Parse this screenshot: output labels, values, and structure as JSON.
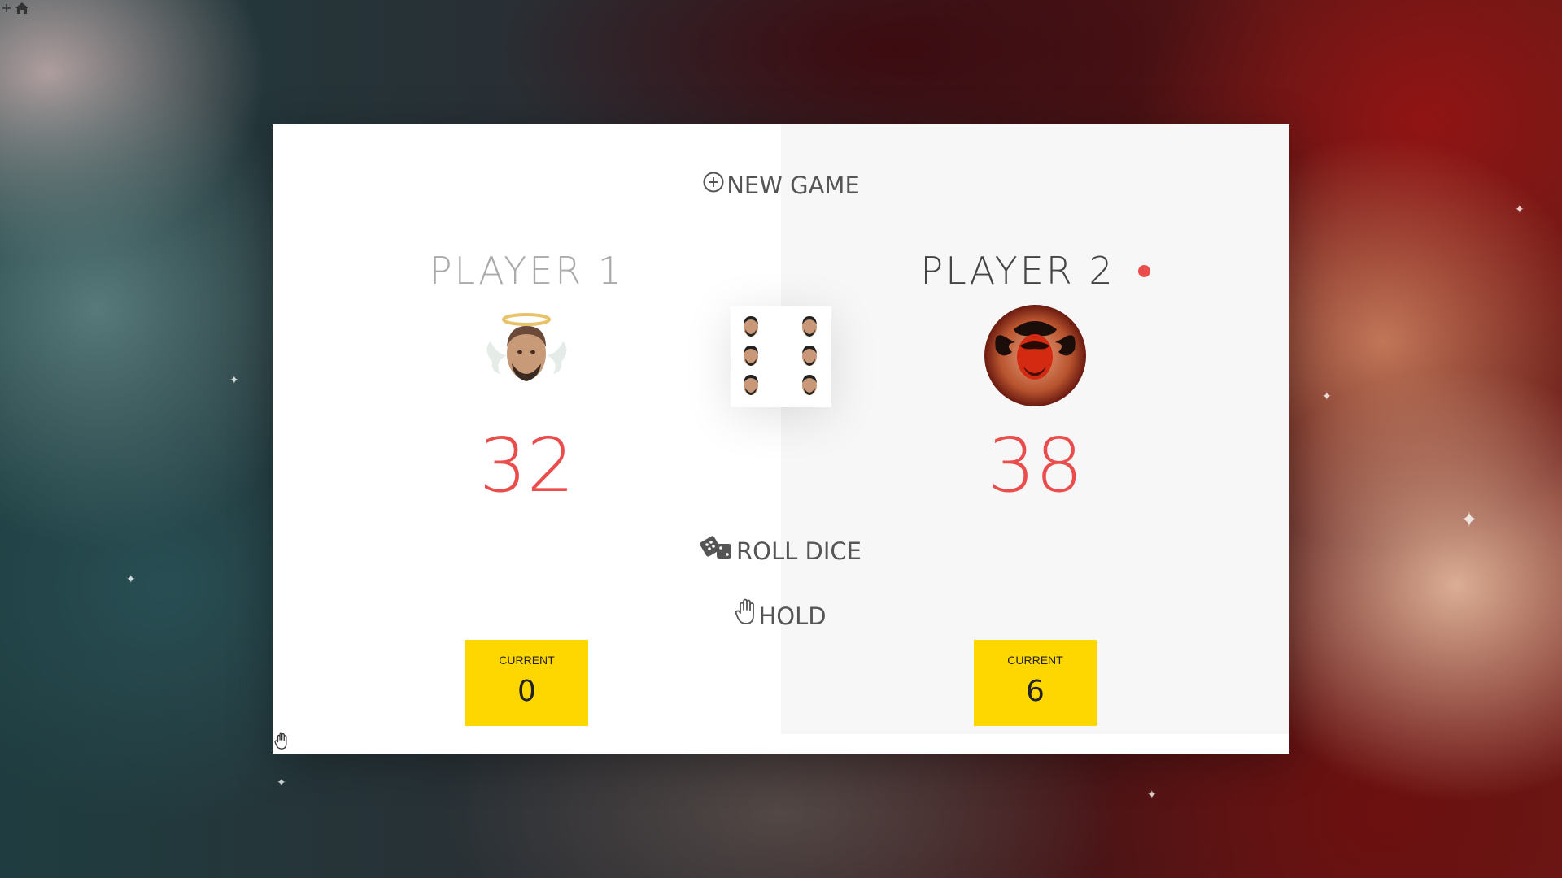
{
  "app": {
    "top_icons": [
      "plus-icon",
      "home-icon"
    ]
  },
  "controls": {
    "new_game": {
      "label": "NEW GAME",
      "icon": "plus-circle-icon"
    },
    "roll_dice": {
      "label": "ROLL DICE",
      "icon": "dice-icon"
    },
    "hold": {
      "label": "HOLD",
      "icon": "hand-icon"
    }
  },
  "players": [
    {
      "name": "PLAYER 1",
      "score": "32",
      "current_label": "CURRENT",
      "current_score": "0",
      "active": false,
      "avatar": "angel-avatar"
    },
    {
      "name": "PLAYER 2",
      "score": "38",
      "current_label": "CURRENT",
      "current_score": "6",
      "active": true,
      "avatar": "devil-avatar"
    }
  ],
  "dice": {
    "value": 6,
    "style": "face-pips"
  },
  "colors": {
    "accent": "#eb4d4d",
    "current_box": "#ffd700",
    "text": "#555555",
    "inactive_name": "#aaaaaa",
    "right_panel": "#f7f7f7"
  }
}
